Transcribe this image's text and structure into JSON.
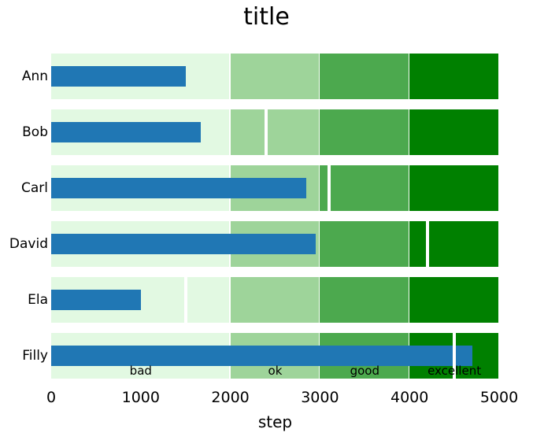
{
  "chart_data": {
    "type": "bar",
    "subtype": "bullet",
    "orientation": "horizontal",
    "title": "title",
    "xlabel": "step",
    "ylabel": "",
    "xlim": [
      0,
      5000
    ],
    "xticks": [
      0,
      1000,
      2000,
      3000,
      4000,
      5000
    ],
    "xticklabels": [
      "0",
      "1000",
      "2000",
      "3000",
      "4000",
      "5000"
    ],
    "grid": false,
    "legend": "none",
    "categories": [
      "Ann",
      "Bob",
      "Carl",
      "David",
      "Ela",
      "Filly"
    ],
    "values": [
      1500,
      1670,
      2850,
      2950,
      1000,
      4700
    ],
    "targets": [
      null,
      2400,
      3100,
      4200,
      1500,
      4500
    ],
    "series": [
      {
        "name": "step",
        "values": [
          1500,
          1670,
          2850,
          2950,
          1000,
          4700
        ]
      }
    ],
    "bands": [
      {
        "label": "bad",
        "start": 0,
        "end": 2000,
        "color": "#e2f9e2"
      },
      {
        "label": "ok",
        "start": 2000,
        "end": 3000,
        "color": "#9ed49a"
      },
      {
        "label": "good",
        "start": 3000,
        "end": 4000,
        "color": "#4ca94e"
      },
      {
        "label": "excellent",
        "start": 4000,
        "end": 5000,
        "color": "#008000"
      }
    ],
    "bar_color": "#2077b4",
    "target_color": "#ffffff",
    "rows": [
      {
        "category": "Ann",
        "value": 1500,
        "target": null
      },
      {
        "category": "Bob",
        "value": 1670,
        "target": 2400
      },
      {
        "category": "Carl",
        "value": 2850,
        "target": 3100
      },
      {
        "category": "David",
        "value": 2950,
        "target": 4200
      },
      {
        "category": "Ela",
        "value": 1000,
        "target": 1500
      },
      {
        "category": "Filly",
        "value": 4700,
        "target": 4500
      }
    ]
  },
  "title": {
    "text": "title"
  },
  "axis": {
    "x_label": "step",
    "ticks": [
      {
        "value": 0,
        "label": "0"
      },
      {
        "value": 1000,
        "label": "1000"
      },
      {
        "value": 2000,
        "label": "2000"
      },
      {
        "value": 3000,
        "label": "3000"
      },
      {
        "value": 4000,
        "label": "4000"
      },
      {
        "value": 5000,
        "label": "5000"
      }
    ]
  },
  "categories": [
    {
      "label": "Ann"
    },
    {
      "label": "Bob"
    },
    {
      "label": "Carl"
    },
    {
      "label": "David"
    },
    {
      "label": "Ela"
    },
    {
      "label": "Filly"
    }
  ],
  "band_labels": [
    {
      "label": "bad"
    },
    {
      "label": "ok"
    },
    {
      "label": "good"
    },
    {
      "label": "excellent"
    }
  ],
  "colors": {
    "bar": "#2077b4",
    "target": "#ffffff",
    "band_bad": "#e2f9e2",
    "band_ok": "#9ed49a",
    "band_good": "#4ca94e",
    "band_excellent": "#008000",
    "text": "#000000",
    "background": "#ffffff"
  }
}
